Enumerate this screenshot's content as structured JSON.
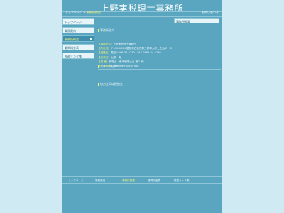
{
  "header": {
    "site_title": "上野実税理士事務所",
    "breadcrumb_home": "トップページ",
    "breadcrumb_separator": " > ",
    "breadcrumb_current": "事務所概要",
    "contact_link": "お問い合わせ"
  },
  "sidebar": {
    "items": [
      {
        "label": "トップページ",
        "active": false
      },
      {
        "label": "業務案内",
        "active": false
      },
      {
        "label": "事務所概要",
        "active": true
      },
      {
        "label": "顧問料金表",
        "active": false
      },
      {
        "label": "税務リンク集",
        "active": false
      }
    ]
  },
  "section_tab": "事務所概要",
  "main": {
    "office_heading": "事務所紹介",
    "info": [
      {
        "key": "【事務所名】",
        "value": "上野実税理士事務所"
      },
      {
        "key": "【所在地】",
        "value": "〒470-0204 愛知県西加茂郡三好町大字上之山２－１"
      },
      {
        "key": "【連絡先】",
        "value": "電話 0566-34-4730　FAX 0566-34-4730"
      },
      {
        "key": "【代表者】",
        "value": "上野　実"
      },
      {
        "key": "【資 格】",
        "value": "税理士（東海税理士会 第１号）"
      },
      {
        "key": "【所属団体】",
        "value": "東海税理士会刈谷支部"
      }
    ],
    "staff_heading": "スタッフ紹介",
    "partner_heading": "協力先又は提携先"
  },
  "footer": {
    "links": [
      {
        "label": "トップページ",
        "active": false
      },
      {
        "label": "業務案内",
        "active": false
      },
      {
        "label": "事務所概要",
        "active": true
      },
      {
        "label": "顧問料金表",
        "active": false
      },
      {
        "label": "税務リンク集",
        "active": false
      }
    ]
  },
  "colors": {
    "page_bg": "#cfeaf2",
    "frame_bg": "#5aa6c0",
    "accent": "#f0f07a"
  }
}
